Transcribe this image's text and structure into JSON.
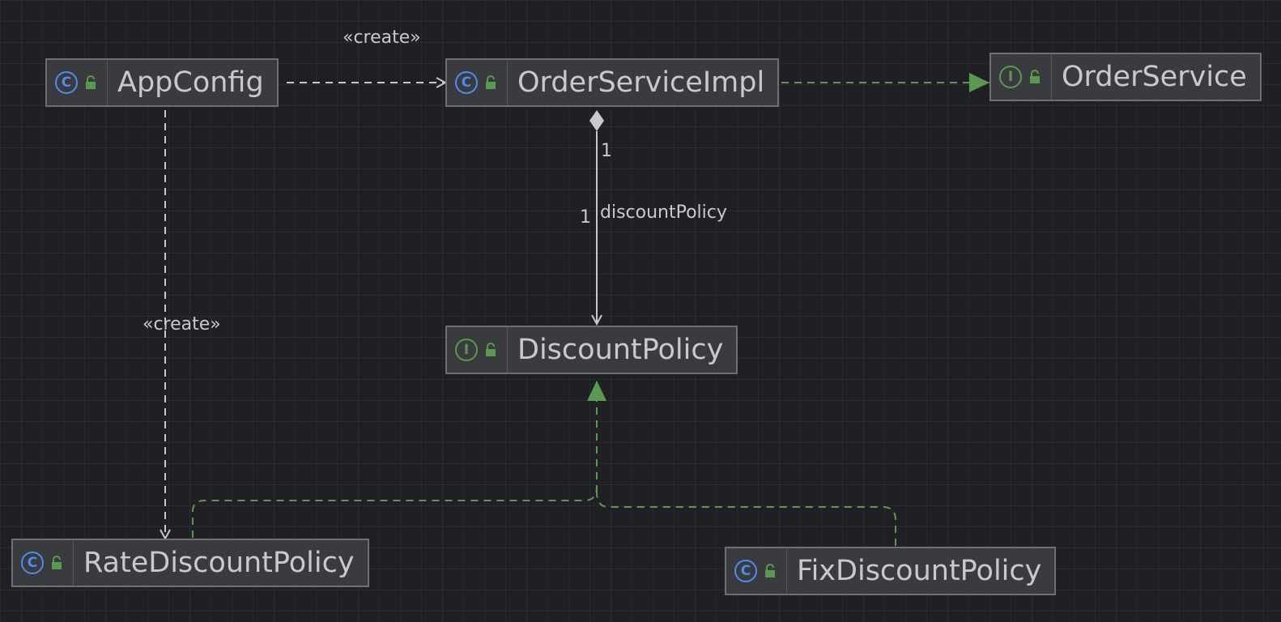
{
  "diagram": {
    "nodes": [
      {
        "id": "appconfig",
        "name": "AppConfig",
        "kind": "class",
        "kind_glyph": "C",
        "visibility_icon": "unlock-icon"
      },
      {
        "id": "orderserviceimpl",
        "name": "OrderServiceImpl",
        "kind": "class",
        "kind_glyph": "C",
        "visibility_icon": "unlock-icon"
      },
      {
        "id": "orderservice",
        "name": "OrderService",
        "kind": "interface",
        "kind_glyph": "I",
        "visibility_icon": "unlock-icon"
      },
      {
        "id": "discountpolicy",
        "name": "DiscountPolicy",
        "kind": "interface",
        "kind_glyph": "I",
        "visibility_icon": "unlock-icon"
      },
      {
        "id": "ratediscountpolicy",
        "name": "RateDiscountPolicy",
        "kind": "class",
        "kind_glyph": "C",
        "visibility_icon": "unlock-icon"
      },
      {
        "id": "fixdiscountpolicy",
        "name": "FixDiscountPolicy",
        "kind": "class",
        "kind_glyph": "C",
        "visibility_icon": "unlock-icon"
      }
    ],
    "edges": [
      {
        "from": "appconfig",
        "to": "orderserviceimpl",
        "type": "dependency",
        "label": "«create»"
      },
      {
        "from": "appconfig",
        "to": "ratediscountpolicy",
        "type": "dependency",
        "label": "«create»"
      },
      {
        "from": "orderserviceimpl",
        "to": "orderservice",
        "type": "realization"
      },
      {
        "from": "orderserviceimpl",
        "to": "discountpolicy",
        "type": "composition",
        "label": "discountPolicy",
        "source_multiplicity": "1",
        "target_multiplicity": "1"
      },
      {
        "from": "ratediscountpolicy",
        "to": "discountpolicy",
        "type": "realization"
      },
      {
        "from": "fixdiscountpolicy",
        "to": "discountpolicy",
        "type": "realization"
      }
    ]
  },
  "colors": {
    "background": "#1f2024",
    "node_fill": "#3a3b3e",
    "node_border": "#6e6f73",
    "class_icon": "#4e8cf0",
    "interface_icon": "#5a9a4e",
    "realization_edge": "#5a9a4e",
    "dependency_edge": "#c8c9cc",
    "text": "#c8c9cc"
  }
}
